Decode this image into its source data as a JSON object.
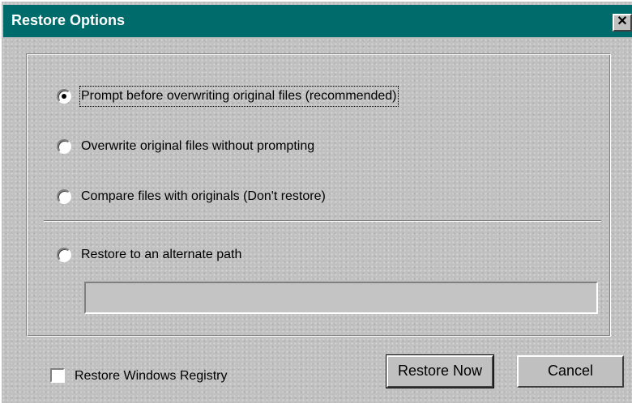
{
  "window": {
    "title": "Restore Options",
    "close_glyph": "✕"
  },
  "options": [
    {
      "label": "Prompt before overwriting original files (recommended)",
      "selected": true
    },
    {
      "label": "Overwrite original files without prompting",
      "selected": false
    },
    {
      "label": "Compare files with originals (Don't restore)",
      "selected": false
    },
    {
      "label": "Restore to an alternate path",
      "selected": false
    }
  ],
  "alternate_path": {
    "value": ""
  },
  "registry_checkbox": {
    "label": "Restore Windows Registry",
    "checked": false
  },
  "buttons": {
    "restore_now": "Restore Now",
    "cancel": "Cancel"
  },
  "colors": {
    "titlebar": "#006b6b",
    "face": "#c0c0c0"
  }
}
